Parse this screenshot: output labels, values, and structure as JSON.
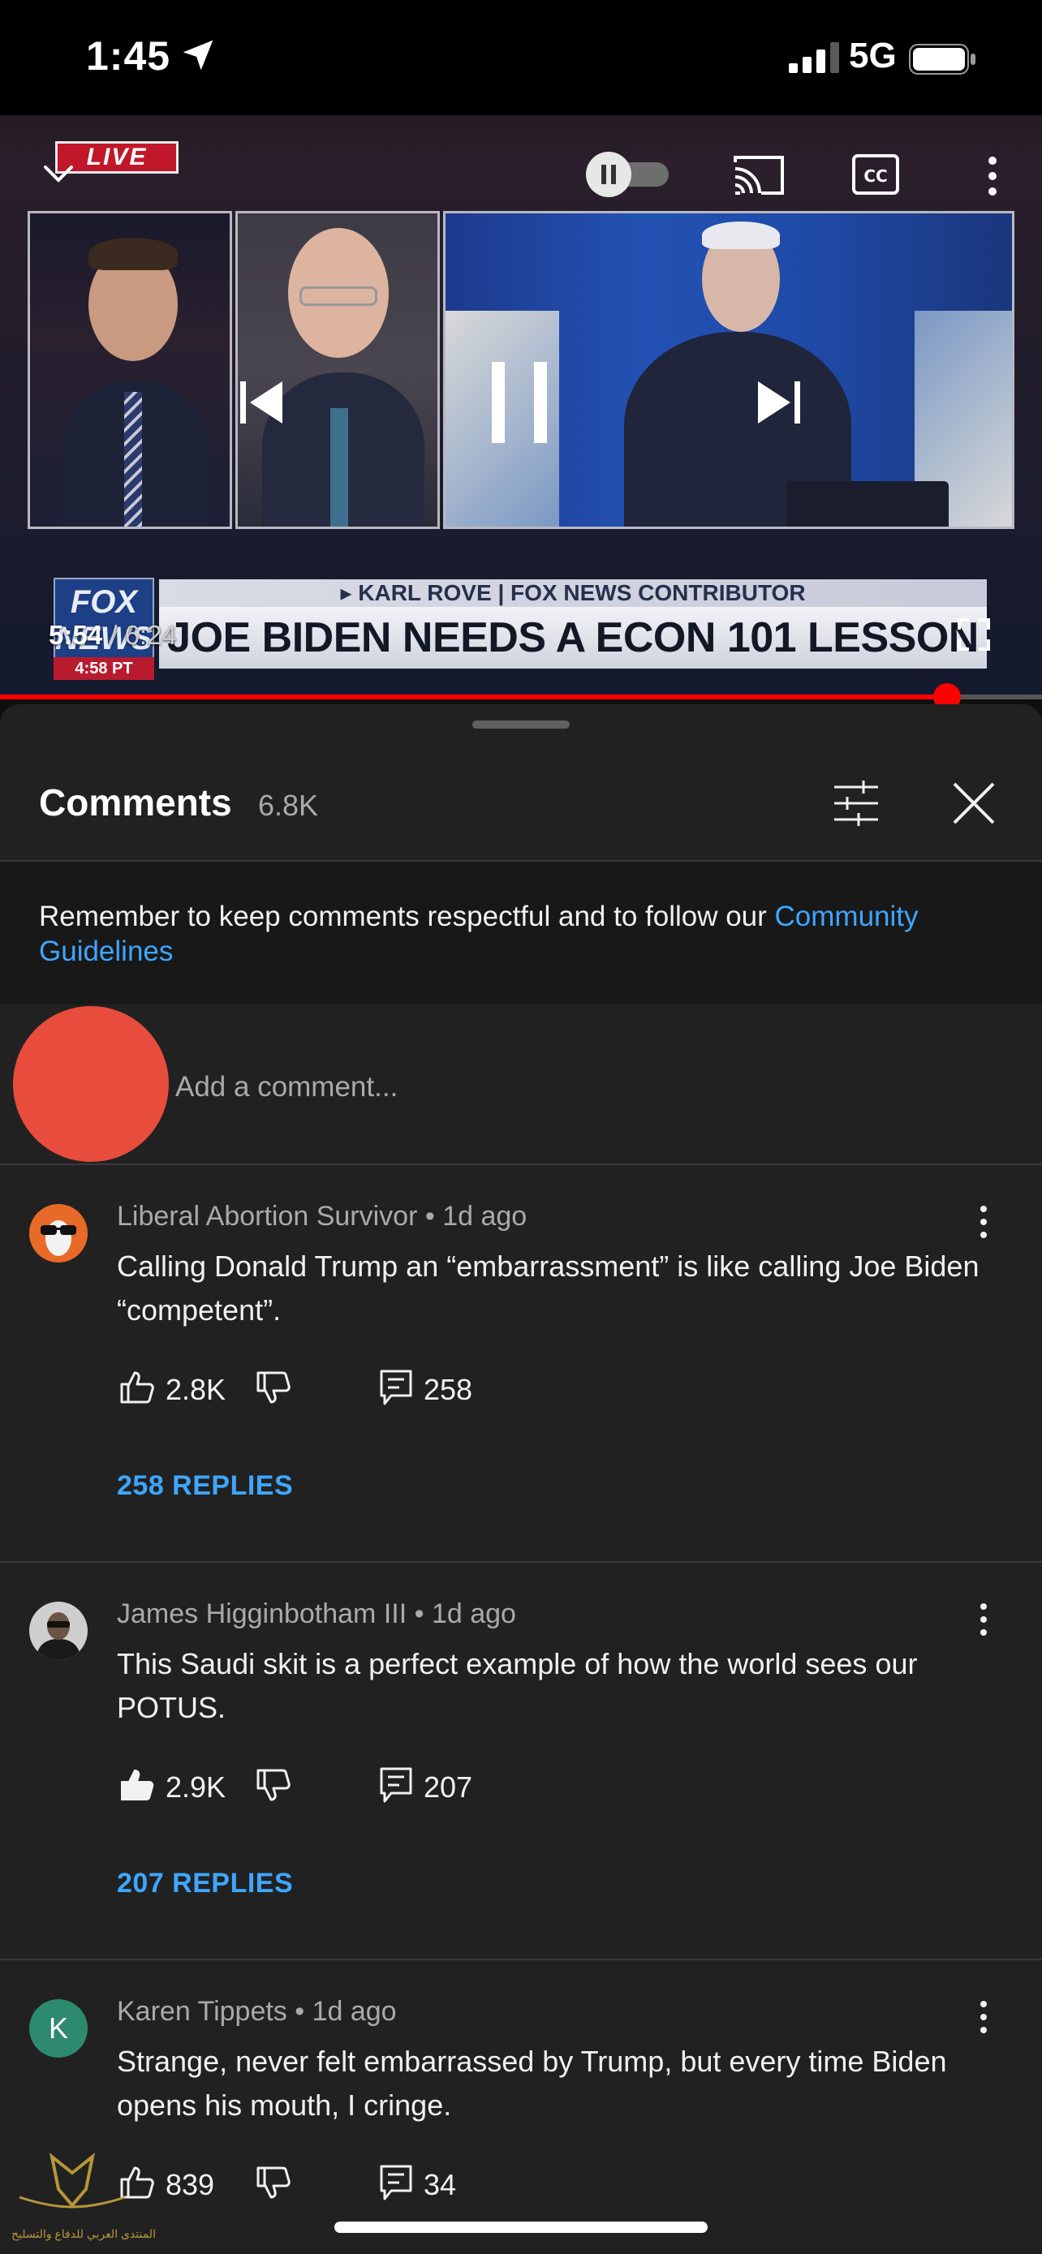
{
  "status_bar": {
    "time": "1:45",
    "network": "5G"
  },
  "video": {
    "live_badge": "LIVE",
    "network_logo": "FOX NEWS",
    "clock": "4:58 PT",
    "banner_top": "▸ KARL ROVE | FOX NEWS CONTRIBUTOR",
    "banner_main": "JOE BIDEN NEEDS A ECON 101 LESSON",
    "current_time": "5:54",
    "duration": "6:24",
    "progress_fraction": 0.909,
    "accent_color": "#ff0000"
  },
  "comments_panel": {
    "title": "Comments",
    "count": "6.8K",
    "guidelines_text": "Remember to keep comments respectful and to follow our ",
    "guidelines_link": "Community Guidelines",
    "add_placeholder": "Add a comment...",
    "link_color": "#3ea6ff"
  },
  "comments": [
    {
      "author": "Liberal Abortion Survivor",
      "age": "1d ago",
      "text": "Calling Donald Trump an “embarrassment” is like calling Joe Biden “competent”.",
      "likes": "2.8K",
      "reply_count": "258",
      "replies_label": "258 REPLIES",
      "avatar": "goat-sunglasses-icon"
    },
    {
      "author": "James Higginbotham III",
      "age": "1d ago",
      "text": "This Saudi skit is a perfect example of how the world sees our POTUS.",
      "likes": "2.9K",
      "reply_count": "207",
      "replies_label": "207 REPLIES",
      "avatar": "photo-avatar"
    },
    {
      "author": "Karen Tippets",
      "age": "1d ago",
      "text": "Strange, never felt embarrassed by Trump, but every time Biden opens his mouth, I cringe.",
      "likes": "839",
      "reply_count": "34",
      "avatar_letter": "K",
      "avatar_color": "#2d8a6e"
    }
  ],
  "watermark_text": "المنتدى العربي للدفاع والتسليح"
}
